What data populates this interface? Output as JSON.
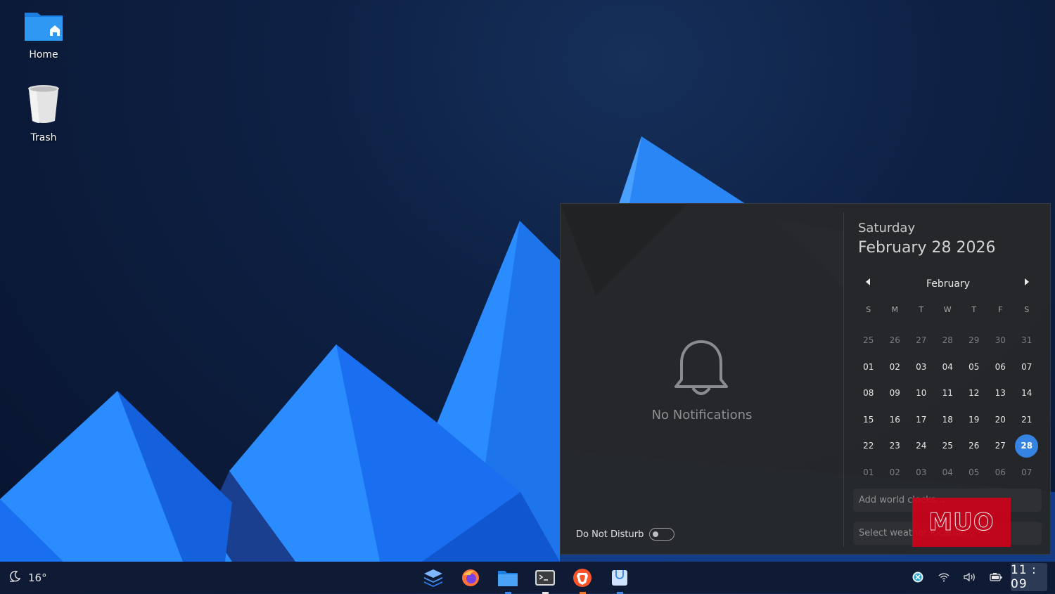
{
  "desktop": {
    "icons": [
      {
        "label": "Home",
        "icon": "home-folder-icon"
      },
      {
        "label": "Trash",
        "icon": "trash-icon"
      }
    ]
  },
  "notifications": {
    "empty_text": "No Notifications",
    "bell_icon": "bell-icon",
    "dnd_label": "Do Not Disturb",
    "dnd_enabled": false
  },
  "calendar": {
    "weekday": "Saturday",
    "full_date": "February 28 2026",
    "month": "February",
    "weekday_headers": [
      "S",
      "M",
      "T",
      "W",
      "T",
      "F",
      "S"
    ],
    "weeks": [
      [
        "25",
        "26",
        "27",
        "28",
        "29",
        "30",
        "31"
      ],
      [
        "01",
        "02",
        "03",
        "04",
        "05",
        "06",
        "07"
      ],
      [
        "08",
        "09",
        "10",
        "11",
        "12",
        "13",
        "14"
      ],
      [
        "15",
        "16",
        "17",
        "18",
        "19",
        "20",
        "21"
      ],
      [
        "22",
        "23",
        "24",
        "25",
        "26",
        "27",
        "28"
      ],
      [
        "01",
        "02",
        "03",
        "04",
        "05",
        "06",
        "07"
      ]
    ],
    "dim_weeks": [
      0,
      5
    ],
    "today": "28",
    "accent": "#3584e4",
    "world_clocks_placeholder": "Add world clocks…",
    "weather_placeholder": "Select weather location…"
  },
  "watermark": {
    "text": "MUO",
    "color": "#d0021b"
  },
  "taskbar": {
    "weather": {
      "icon": "weather-night-icon",
      "temperature": "16°"
    },
    "apps": [
      {
        "name": "stack-app-icon",
        "running": false
      },
      {
        "name": "firefox-icon",
        "running": false
      },
      {
        "name": "files-icon",
        "running": true,
        "dot_color": "#3d8be8"
      },
      {
        "name": "terminal-icon",
        "running": true,
        "dot_color": "#e6e6e6"
      },
      {
        "name": "brave-icon",
        "running": true,
        "dot_color": "#f07a2c"
      },
      {
        "name": "software-store-icon",
        "running": true,
        "dot_color": "#3d8be8"
      }
    ],
    "tray": [
      "update-icon",
      "wifi-icon",
      "volume-icon",
      "battery-icon"
    ],
    "clock": "11 : 09"
  }
}
